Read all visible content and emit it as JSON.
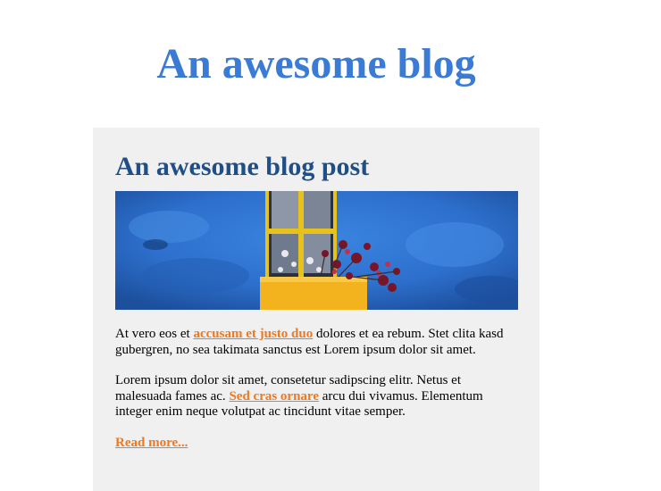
{
  "header": {
    "site_title": "An awesome blog"
  },
  "post": {
    "title": "An awesome blog post",
    "image_alt": "blue wall with yellow window and flower box",
    "paragraph1": {
      "before": "At vero eos et ",
      "link": "accusam et justo duo",
      "after": " dolores et ea rebum. Stet clita kasd gubergren, no sea takimata sanctus est Lorem ipsum dolor sit amet."
    },
    "paragraph2": {
      "before": "Lorem ipsum dolor sit amet, consetetur sadipscing elitr. Netus et malesuada fames ac. ",
      "link": "Sed cras ornare",
      "after": " arcu dui vivamus. Elementum integer enim neque volutpat ac tincidunt vitae semper."
    },
    "read_more": "Read more..."
  },
  "colors": {
    "site_title": "#3a7bd5",
    "post_title": "#1f4f86",
    "link": "#f0781e",
    "card_background": "#f0f0f0"
  }
}
